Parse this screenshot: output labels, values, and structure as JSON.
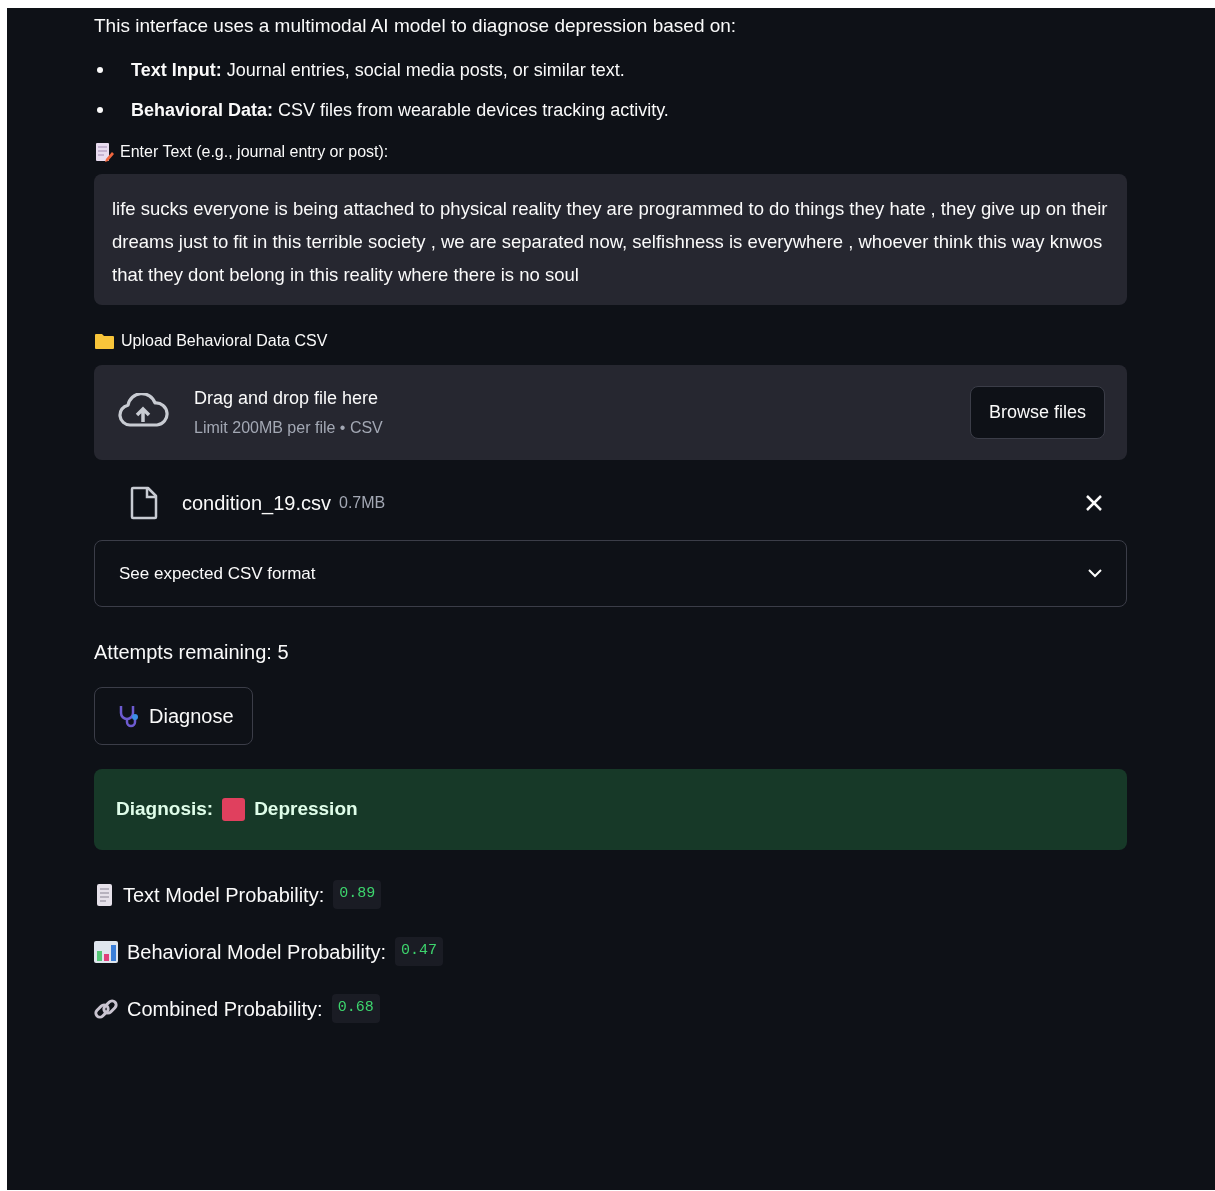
{
  "intro": "This interface uses a multimodal AI model to diagnose depression based on:",
  "bullets": [
    {
      "term": "Text Input:",
      "text": "Journal entries, social media posts, or similar text."
    },
    {
      "term": "Behavioral Data:",
      "text": "CSV files from wearable devices tracking activity."
    }
  ],
  "text_input": {
    "label": "Enter Text (e.g., journal entry or post):",
    "value": "life sucks everyone is being attached to physical reality they are programmed to do things they hate , they give up on their dreams just to fit in this terrible society , we are separated now, selfishness is everywhere , whoever think this way knwos that they dont belong in this reality where there is no soul"
  },
  "uploader": {
    "label": "Upload Behavioral Data CSV",
    "drop_text": "Drag and drop file here",
    "limit": "Limit 200MB per file • CSV",
    "button": "Browse files",
    "file": {
      "name": "condition_19.csv",
      "size": "0.7MB"
    }
  },
  "expander": {
    "label": "See expected CSV format",
    "expanded": false
  },
  "attempts": "Attempts remaining: 5",
  "diagnose_button": "Diagnose",
  "diagnosis": {
    "label": "Diagnosis:",
    "result": "Depression",
    "color": "#e0405e"
  },
  "probabilities": [
    {
      "kind": "text",
      "label": "Text Model Probability:",
      "value": "0.89"
    },
    {
      "kind": "behavioral",
      "label": "Behavioral Model Probability:",
      "value": "0.47"
    },
    {
      "kind": "combined",
      "label": "Combined Probability:",
      "value": "0.68"
    }
  ]
}
